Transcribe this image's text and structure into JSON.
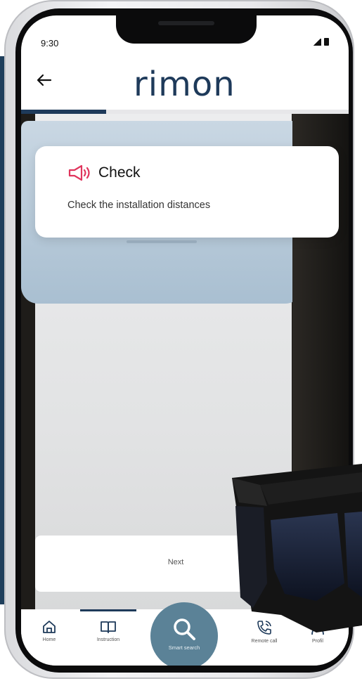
{
  "status_bar": {
    "time": "9:30"
  },
  "header": {
    "back_icon": "arrow-left-icon",
    "logo": "rimon"
  },
  "progress": {
    "fraction": 0.26,
    "color": "#1e3a5a"
  },
  "info_card": {
    "icon": "megaphone-icon",
    "icon_color": "#e0355d",
    "title": "Check",
    "text": "Check the installation distances"
  },
  "next_button": {
    "label": "Next"
  },
  "bottom_nav": {
    "items": [
      {
        "label": "Home",
        "icon": "home-icon"
      },
      {
        "label": "Instruction",
        "icon": "book-icon"
      },
      {
        "label": "Remote call",
        "icon": "phone-call-icon"
      },
      {
        "label": "Profil",
        "icon": "person-icon"
      }
    ],
    "fab": {
      "label": "Smart search",
      "icon": "search-icon",
      "color": "#5b8297"
    }
  },
  "colors": {
    "brand": "#1e3a5a",
    "accent": "#e0355d"
  }
}
